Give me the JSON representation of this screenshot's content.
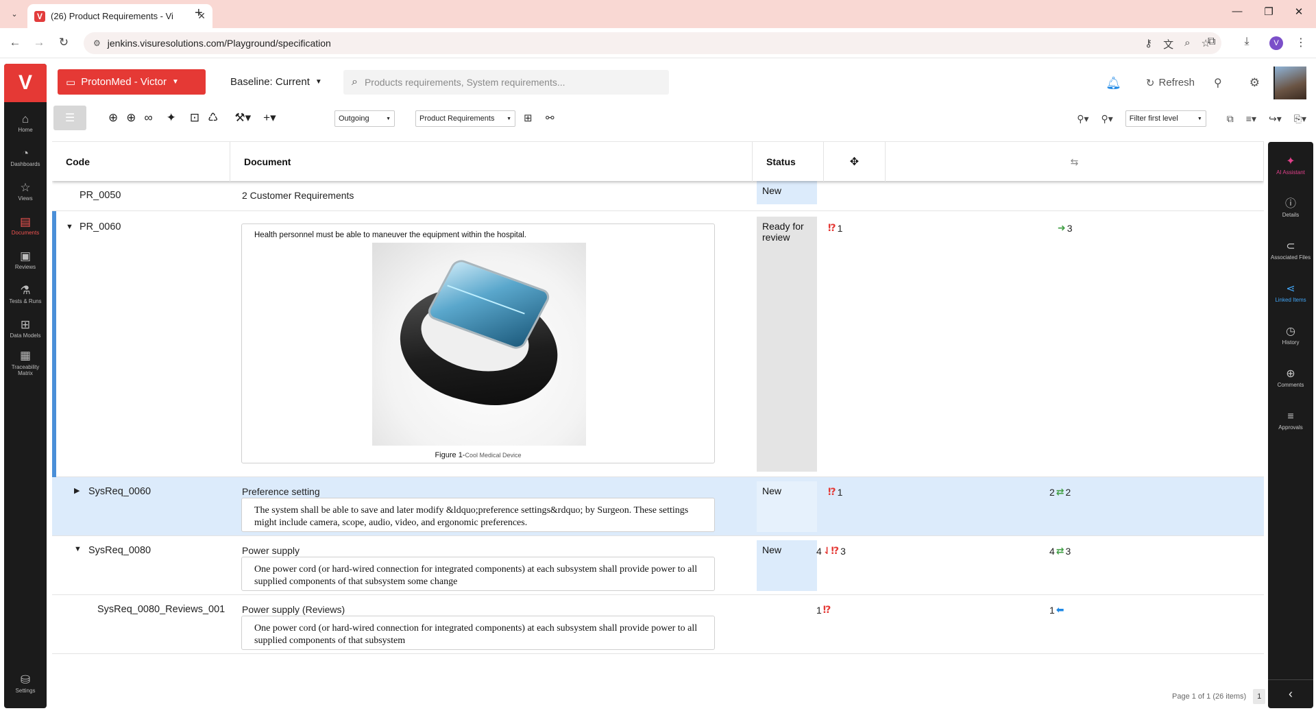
{
  "browser": {
    "tab_title": "(26) Product Requirements - Vi",
    "url": "jenkins.visuresolutions.com/Playground/specification",
    "profile_initial": "V"
  },
  "sidebar": {
    "logo": "V",
    "items": [
      {
        "label": "Home",
        "icon": "home-icon",
        "glyph": "⌂"
      },
      {
        "label": "Dashboards",
        "icon": "dashboard-icon",
        "glyph": "◔"
      },
      {
        "label": "Views",
        "icon": "star-icon",
        "glyph": "☆"
      },
      {
        "label": "Documents",
        "icon": "document-icon",
        "glyph": "▤"
      },
      {
        "label": "Reviews",
        "icon": "review-icon",
        "glyph": "▣"
      },
      {
        "label": "Tests & Runs",
        "icon": "flask-icon",
        "glyph": "⚗"
      },
      {
        "label": "Data Models",
        "icon": "model-icon",
        "glyph": "⊞"
      },
      {
        "label": "Traceability Matrix",
        "icon": "matrix-icon",
        "glyph": "▦"
      }
    ],
    "settings_label": "Settings"
  },
  "header": {
    "project": "ProtonMed - Victor",
    "baseline": "Baseline: Current",
    "search_placeholder": "Products requirements, System requirements...",
    "refresh": "Refresh"
  },
  "toolbar": {
    "direction": "Outgoing",
    "document": "Product Requirements",
    "filter": "Filter first level"
  },
  "grid": {
    "columns": [
      "Code",
      "Document",
      "Status"
    ],
    "rows": [
      {
        "code": "PR_0050",
        "title": "2 Customer Requirements",
        "status": "New"
      },
      {
        "code": "PR_0060",
        "description": "Health personnel must be able to maneuver the equipment within the hospital.",
        "figure_caption": "Figure 1-",
        "figure_caption_small": "Cool Medical Device",
        "status": "Ready for review",
        "incoming": "1",
        "outgoing": "3"
      },
      {
        "code": "SysReq_0060",
        "title": "Preference setting",
        "description": "The system shall be able to save and later modify &ldquo;preference settings&rdquo; by Surgeon. These settings might include camera, scope, audio, video, and ergonomic preferences.",
        "status": "New",
        "incoming": "1",
        "out_left": "2",
        "out_right": "2"
      },
      {
        "code": "SysReq_0080",
        "title": "Power supply",
        "description": "One power cord (or hard-wired connection for integrated components) at each subsystem shall provide power to all supplied components of that subsystem some change",
        "status": "New",
        "in_left": "4",
        "in_right": "3",
        "out_left": "4",
        "out_right": "3"
      },
      {
        "code": "SysReq_0080_Reviews_001",
        "title": "Power supply (Reviews)",
        "description": "One power cord (or hard-wired connection for integrated components) at each subsystem shall provide power to all supplied components of that subsystem",
        "in_left": "1",
        "out_left": "1"
      }
    ]
  },
  "right_panel": {
    "items": [
      {
        "label": "AI Assistant",
        "icon": "ai-sparkle-icon",
        "glyph": "✦"
      },
      {
        "label": "Details",
        "icon": "info-icon",
        "glyph": "ⓘ"
      },
      {
        "label": "Associated Files",
        "icon": "paperclip-icon",
        "glyph": "⊂"
      },
      {
        "label": "Linked Items",
        "icon": "share-icon",
        "glyph": "⋖"
      },
      {
        "label": "History",
        "icon": "history-icon",
        "glyph": "◷"
      },
      {
        "label": "Comments",
        "icon": "comment-icon",
        "glyph": "⊕"
      },
      {
        "label": "Approvals",
        "icon": "approvals-icon",
        "glyph": "≡"
      }
    ]
  },
  "pager": {
    "text": "Page 1 of 1 (26 items)",
    "page": "1"
  },
  "colors": {
    "brand": "#e53935",
    "accent": "#1e88e5",
    "selected_row": "#dcebfb"
  }
}
